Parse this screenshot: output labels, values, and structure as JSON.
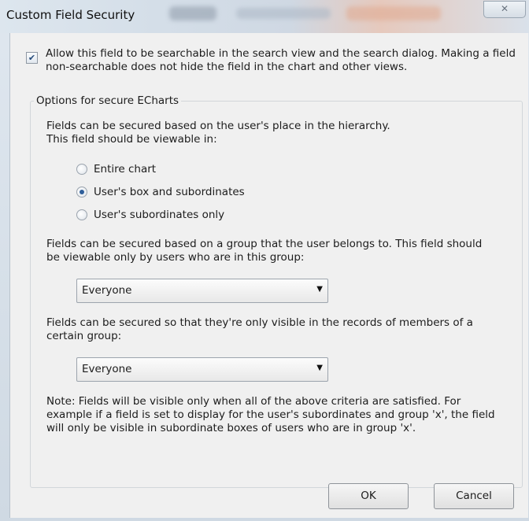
{
  "dialog": {
    "title": "Custom Field Security",
    "close_icon_glyph": "✕"
  },
  "searchable": {
    "checked": true,
    "check_glyph": "✔",
    "label": "Allow this field to be searchable in the search view and the search dialog. Making a field non-searchable does not hide the field in the chart and other views."
  },
  "group": {
    "legend": "Options for secure ECharts",
    "hierarchy_text": "Fields can be secured based on the user's place in the hierarchy.\nThis field should be viewable in:",
    "radio_options": [
      {
        "label": "Entire chart",
        "selected": false
      },
      {
        "label": "User's box and subordinates",
        "selected": true
      },
      {
        "label": "User's subordinates only",
        "selected": false
      }
    ],
    "group_text": "Fields can be secured based on a group that the user belongs to. This field should be viewable only by users who are in this group:",
    "group_select_value": "Everyone",
    "records_text": "Fields can be secured so that they're only visible in the records of members of a certain group:",
    "records_select_value": "Everyone",
    "note_text": "Note: Fields will be visible only when all of the above criteria are satisfied. For example if a field is set to display for the user's subordinates and group 'x', the field will only be visible in subordinate boxes of users who are in group 'x'."
  },
  "buttons": {
    "ok_label": "OK",
    "cancel_label": "Cancel"
  },
  "colors": {
    "accent": "#2f5f9a",
    "window_bg": "#f0f0f0"
  }
}
